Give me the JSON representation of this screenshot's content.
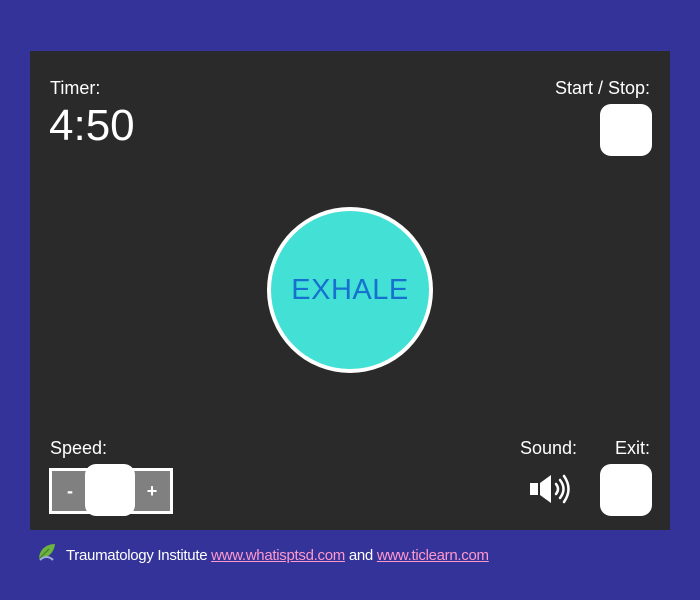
{
  "timer": {
    "label": "Timer:",
    "value": "4:50"
  },
  "start_stop": {
    "label": "Start / Stop:"
  },
  "breath": {
    "text": "EXHALE"
  },
  "speed": {
    "label": "Speed:",
    "minus": "-",
    "plus": "+"
  },
  "sound": {
    "label": "Sound:",
    "icon": "speaker-icon"
  },
  "exit": {
    "label": "Exit:"
  },
  "footer": {
    "org": "Traumatology Institute",
    "link1": "www.whatisptsd.com",
    "and": "and",
    "link2": "www.ticlearn.com",
    "icon": "leaf-icon"
  },
  "colors": {
    "background": "#333399",
    "panel": "#2a2a2a",
    "circle": "#42e0d5",
    "breath_text": "#1570cf",
    "link": "#ff99cc"
  }
}
